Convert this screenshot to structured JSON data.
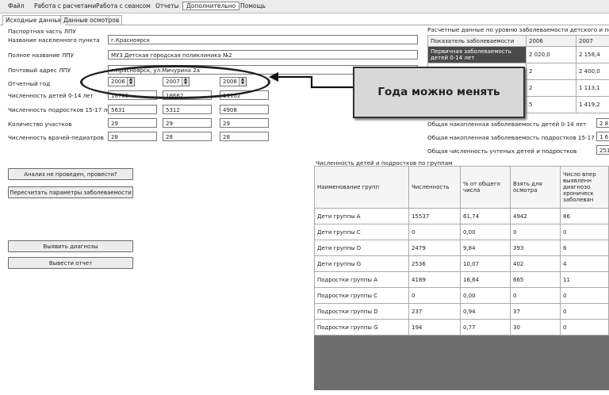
{
  "menu": {
    "items": [
      "Файл",
      "Работа с расчетами",
      "Работа с сеансом",
      "Отчеты",
      "Дополнительно",
      "Помощь"
    ]
  },
  "tabs": [
    "Исходные данные",
    "Данные осмотров"
  ],
  "passport": {
    "section_label": "Паспортная часть ЛПУ",
    "settlement_label": "Название населенного пункта",
    "settlement_value": "г.Красноярск",
    "full_name_label": "Полное название ЛПУ",
    "full_name_value": "МУЗ Детская городская поликлиника №2",
    "address_label": "Почтовый адрес ЛПУ",
    "address_value": "г.Красноярск, ул.Мичурина 2а",
    "year_label": "Отчетный год",
    "years": [
      "2006",
      "2007",
      "2008"
    ],
    "children_label": "Численность детей 0-14 лет",
    "children_values": [
      "18705",
      "18662",
      "19102"
    ],
    "teens_label": "Численность подростков 15-17 лет",
    "teens_values": [
      "5631",
      "5312",
      "4908"
    ],
    "districts_label": "Количество участков",
    "districts_values": [
      "29",
      "29",
      "29"
    ],
    "pediatricians_label": "Численность врачей-педиатров",
    "pediatricians_values": [
      "28",
      "28",
      "28"
    ]
  },
  "buttons": {
    "analysis": "Анализ не проведен, провести?",
    "recalc": "Пересчитать параметры заболеваемости",
    "diagnoses": "Выявить диагнозы",
    "report": "Вывести отчет"
  },
  "calc": {
    "title": "Расчетные данные по уровню заболеваемости детского и подр",
    "headers": [
      "Показатель заболеваемости",
      "2006",
      "2007"
    ],
    "rows": [
      [
        "Первичная заболеваемость детей 0-14 лет",
        "2 020,0",
        "2 158,4"
      ],
      [
        "",
        "2",
        "2 400,0"
      ],
      [
        "",
        "2",
        "1 113,1"
      ],
      [
        "",
        "5",
        "1 419,2"
      ]
    ],
    "cum_children_label": "Общая накопленная заболеваемость детей 0-14 лет",
    "cum_children_value": "2 8",
    "cum_teens_label": "Общая накопленная заболеваемость подростков 15-17 лет",
    "cum_teens_value": "1 6",
    "total_label": "Общая численность учтеных детей и подростков",
    "total_value": "251"
  },
  "groups": {
    "title": "Численность детей и подростков по группам",
    "headers": [
      "Наименование групп",
      "Численность",
      "% от общего числа",
      "Взять для осмотра",
      "Число впер выявленн диагнозо хроническ заболеван"
    ],
    "rows": [
      [
        "Дети группы A",
        "15537",
        "61,74",
        "4942",
        "86"
      ],
      [
        "Дети группы C",
        "0",
        "0,00",
        "0",
        "0"
      ],
      [
        "Дети группы D",
        "2479",
        "9,84",
        "393",
        "6"
      ],
      [
        "Дети группы G",
        "2536",
        "10,07",
        "402",
        "4"
      ],
      [
        "Подростки группы A",
        "4189",
        "16,64",
        "665",
        "11"
      ],
      [
        "Подростки группы C",
        "0",
        "0,00",
        "0",
        "0"
      ],
      [
        "Подростки группы D",
        "237",
        "0,94",
        "37",
        "0"
      ],
      [
        "Подростки группы G",
        "194",
        "0,77",
        "30",
        "0"
      ]
    ]
  },
  "callout": {
    "text": "Года можно менять"
  }
}
